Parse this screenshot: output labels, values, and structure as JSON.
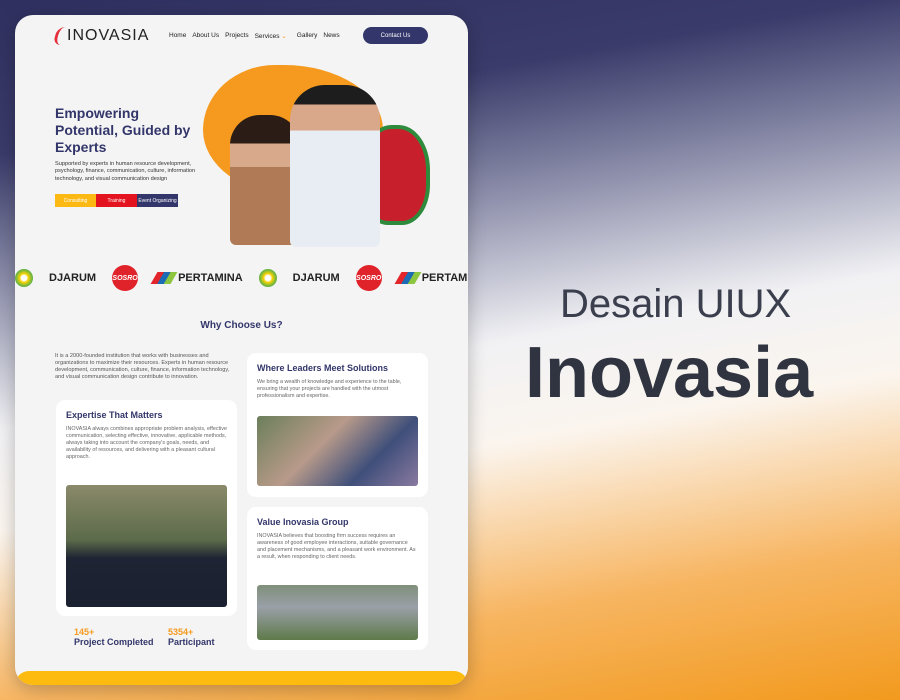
{
  "headline": {
    "line1": "Desain UIUX",
    "line2": "Inovasia"
  },
  "site": {
    "logo": "INOVASIA",
    "nav": [
      "Home",
      "About Us",
      "Projects",
      "Services",
      "Gallery",
      "News"
    ],
    "contact": "Contact Us",
    "hero": {
      "title": "Empowering Potential, Guided by Experts",
      "subtitle": "Supported by experts in human resource development, psychology, finance, communication, culture, information technology, and visual communication design",
      "tags": [
        {
          "label": "Consulting",
          "color": "#fdb913"
        },
        {
          "label": "Training",
          "color": "#e3141f"
        },
        {
          "label": "Event Organizing",
          "color": "#33366a"
        }
      ]
    },
    "partners": [
      "bp",
      "DJARUM",
      "SOSRO",
      "PERTAMINA"
    ],
    "why": {
      "title": "Why Choose Us?",
      "intro": "It is a 2000-founded institution that works with businesses and organizations to maximize their resources. Experts in human resource development, communication, culture, finance, information technology, and visual communication design contribute to innovation.",
      "cards": [
        {
          "title": "Expertise That Matters",
          "text": "INOVASIA always combines appropriate problem analysis, effective communication, selecting effective, innovative, applicable methods, always taking into account the company's goals, needs, and availability of resources, and delivering with a pleasant cultural approach."
        },
        {
          "title": "Where Leaders Meet Solutions",
          "text": "We bring a wealth of knowledge and experience to the table, ensuring that your projects are handled with the utmost professionalism and expertise."
        },
        {
          "title": "Value Inovasia Group",
          "text": "INOVASIA believes that boosting firm success requires an awareness of good employee interactions, suitable governance and placement mechanisms, and a pleasant work environment. As a result, when responding to client needs."
        }
      ]
    },
    "stats": [
      {
        "value": "145+",
        "label": "Project Completed"
      },
      {
        "value": "5354+",
        "label": "Participant"
      }
    ]
  }
}
